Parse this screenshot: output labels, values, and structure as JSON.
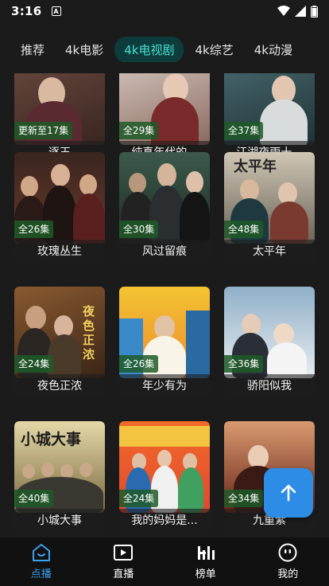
{
  "status_bar": {
    "time": "3:16",
    "notification_badge": "A"
  },
  "tabs": [
    {
      "label": "推荐",
      "active": false
    },
    {
      "label": "4k电影",
      "active": false
    },
    {
      "label": "4k电视剧",
      "active": true
    },
    {
      "label": "4k综艺",
      "active": false
    },
    {
      "label": "4k动漫",
      "active": false
    }
  ],
  "cards": [
    {
      "badge": "更新至17集",
      "title": "逐玉",
      "colors": [
        "#5a3a30",
        "#8a6a5a"
      ]
    },
    {
      "badge": "全29集",
      "title": "纯真年代的...",
      "colors": [
        "#c7b8b0",
        "#7a5a50"
      ]
    },
    {
      "badge": "全37集",
      "title": "江湖夜雨十...",
      "colors": [
        "#2a4a4f",
        "#98b0b6"
      ]
    },
    {
      "badge": "全26集",
      "title": "玫瑰丛生",
      "colors": [
        "#3a2520",
        "#7a4a35"
      ]
    },
    {
      "badge": "全30集",
      "title": "风过留痕",
      "colors": [
        "#2c4a40",
        "#8aa080"
      ]
    },
    {
      "badge": "全48集",
      "title": "太平年",
      "colors": [
        "#c8bfae",
        "#3c3a36"
      ]
    },
    {
      "badge": "全24集",
      "title": "夜色正浓",
      "colors": [
        "#6a4025",
        "#c09040"
      ]
    },
    {
      "badge": "全26集",
      "title": "年少有为",
      "colors": [
        "#f0c028",
        "#3a8ac8"
      ]
    },
    {
      "badge": "全36集",
      "title": "骄阳似我",
      "colors": [
        "#9ab8cc",
        "#e8ecf0"
      ]
    },
    {
      "badge": "全40集",
      "title": "小城大事",
      "colors": [
        "#d8c890",
        "#6a6040"
      ]
    },
    {
      "badge": "全24集",
      "title": "我的妈妈是...",
      "colors": [
        "#f05a28",
        "#3a8ad0"
      ]
    },
    {
      "badge": "全34集",
      "title": "九重紫",
      "colors": [
        "#8a3020",
        "#d8a080"
      ]
    }
  ],
  "poster_text": {
    "card2": "太平年",
    "card6": "夜色正浓",
    "card9": "小城大事"
  },
  "bottom_nav": [
    {
      "label": "点播",
      "icon": "home-icon",
      "active": true
    },
    {
      "label": "直播",
      "icon": "tv-play-icon",
      "active": false
    },
    {
      "label": "榜单",
      "icon": "chart-icon",
      "active": false
    },
    {
      "label": "我的",
      "icon": "profile-icon",
      "active": false
    }
  ],
  "colors": {
    "accent_tab": "#46e1d2",
    "accent_nav": "#3aa2f0",
    "fab": "#2d8ce6"
  }
}
